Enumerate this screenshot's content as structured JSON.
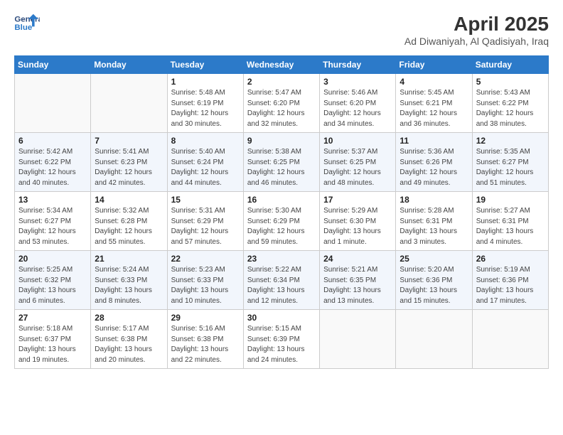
{
  "header": {
    "logo_line1": "General",
    "logo_line2": "Blue",
    "title": "April 2025",
    "subtitle": "Ad Diwaniyah, Al Qadisiyah, Iraq"
  },
  "weekdays": [
    "Sunday",
    "Monday",
    "Tuesday",
    "Wednesday",
    "Thursday",
    "Friday",
    "Saturday"
  ],
  "weeks": [
    [
      {
        "day": "",
        "info": ""
      },
      {
        "day": "",
        "info": ""
      },
      {
        "day": "1",
        "info": "Sunrise: 5:48 AM\nSunset: 6:19 PM\nDaylight: 12 hours\nand 30 minutes."
      },
      {
        "day": "2",
        "info": "Sunrise: 5:47 AM\nSunset: 6:20 PM\nDaylight: 12 hours\nand 32 minutes."
      },
      {
        "day": "3",
        "info": "Sunrise: 5:46 AM\nSunset: 6:20 PM\nDaylight: 12 hours\nand 34 minutes."
      },
      {
        "day": "4",
        "info": "Sunrise: 5:45 AM\nSunset: 6:21 PM\nDaylight: 12 hours\nand 36 minutes."
      },
      {
        "day": "5",
        "info": "Sunrise: 5:43 AM\nSunset: 6:22 PM\nDaylight: 12 hours\nand 38 minutes."
      }
    ],
    [
      {
        "day": "6",
        "info": "Sunrise: 5:42 AM\nSunset: 6:22 PM\nDaylight: 12 hours\nand 40 minutes."
      },
      {
        "day": "7",
        "info": "Sunrise: 5:41 AM\nSunset: 6:23 PM\nDaylight: 12 hours\nand 42 minutes."
      },
      {
        "day": "8",
        "info": "Sunrise: 5:40 AM\nSunset: 6:24 PM\nDaylight: 12 hours\nand 44 minutes."
      },
      {
        "day": "9",
        "info": "Sunrise: 5:38 AM\nSunset: 6:25 PM\nDaylight: 12 hours\nand 46 minutes."
      },
      {
        "day": "10",
        "info": "Sunrise: 5:37 AM\nSunset: 6:25 PM\nDaylight: 12 hours\nand 48 minutes."
      },
      {
        "day": "11",
        "info": "Sunrise: 5:36 AM\nSunset: 6:26 PM\nDaylight: 12 hours\nand 49 minutes."
      },
      {
        "day": "12",
        "info": "Sunrise: 5:35 AM\nSunset: 6:27 PM\nDaylight: 12 hours\nand 51 minutes."
      }
    ],
    [
      {
        "day": "13",
        "info": "Sunrise: 5:34 AM\nSunset: 6:27 PM\nDaylight: 12 hours\nand 53 minutes."
      },
      {
        "day": "14",
        "info": "Sunrise: 5:32 AM\nSunset: 6:28 PM\nDaylight: 12 hours\nand 55 minutes."
      },
      {
        "day": "15",
        "info": "Sunrise: 5:31 AM\nSunset: 6:29 PM\nDaylight: 12 hours\nand 57 minutes."
      },
      {
        "day": "16",
        "info": "Sunrise: 5:30 AM\nSunset: 6:29 PM\nDaylight: 12 hours\nand 59 minutes."
      },
      {
        "day": "17",
        "info": "Sunrise: 5:29 AM\nSunset: 6:30 PM\nDaylight: 13 hours\nand 1 minute."
      },
      {
        "day": "18",
        "info": "Sunrise: 5:28 AM\nSunset: 6:31 PM\nDaylight: 13 hours\nand 3 minutes."
      },
      {
        "day": "19",
        "info": "Sunrise: 5:27 AM\nSunset: 6:31 PM\nDaylight: 13 hours\nand 4 minutes."
      }
    ],
    [
      {
        "day": "20",
        "info": "Sunrise: 5:25 AM\nSunset: 6:32 PM\nDaylight: 13 hours\nand 6 minutes."
      },
      {
        "day": "21",
        "info": "Sunrise: 5:24 AM\nSunset: 6:33 PM\nDaylight: 13 hours\nand 8 minutes."
      },
      {
        "day": "22",
        "info": "Sunrise: 5:23 AM\nSunset: 6:33 PM\nDaylight: 13 hours\nand 10 minutes."
      },
      {
        "day": "23",
        "info": "Sunrise: 5:22 AM\nSunset: 6:34 PM\nDaylight: 13 hours\nand 12 minutes."
      },
      {
        "day": "24",
        "info": "Sunrise: 5:21 AM\nSunset: 6:35 PM\nDaylight: 13 hours\nand 13 minutes."
      },
      {
        "day": "25",
        "info": "Sunrise: 5:20 AM\nSunset: 6:36 PM\nDaylight: 13 hours\nand 15 minutes."
      },
      {
        "day": "26",
        "info": "Sunrise: 5:19 AM\nSunset: 6:36 PM\nDaylight: 13 hours\nand 17 minutes."
      }
    ],
    [
      {
        "day": "27",
        "info": "Sunrise: 5:18 AM\nSunset: 6:37 PM\nDaylight: 13 hours\nand 19 minutes."
      },
      {
        "day": "28",
        "info": "Sunrise: 5:17 AM\nSunset: 6:38 PM\nDaylight: 13 hours\nand 20 minutes."
      },
      {
        "day": "29",
        "info": "Sunrise: 5:16 AM\nSunset: 6:38 PM\nDaylight: 13 hours\nand 22 minutes."
      },
      {
        "day": "30",
        "info": "Sunrise: 5:15 AM\nSunset: 6:39 PM\nDaylight: 13 hours\nand 24 minutes."
      },
      {
        "day": "",
        "info": ""
      },
      {
        "day": "",
        "info": ""
      },
      {
        "day": "",
        "info": ""
      }
    ]
  ]
}
